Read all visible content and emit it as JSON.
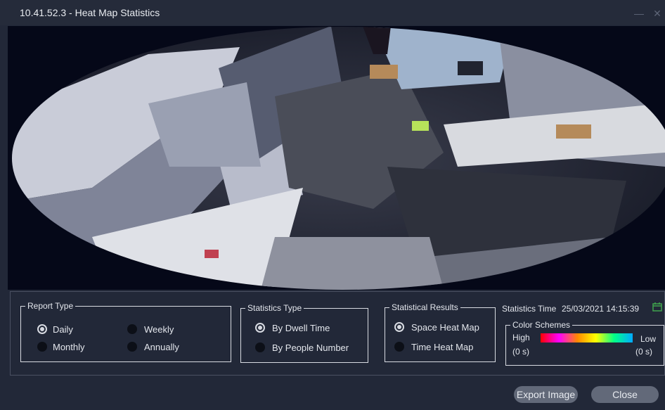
{
  "window": {
    "title": "10.41.52.3 - Heat Map Statistics",
    "minimize_icon": "minimize-icon",
    "close_icon": "close-icon"
  },
  "report_type": {
    "legend": "Report Type",
    "options": [
      {
        "label": "Daily",
        "selected": true
      },
      {
        "label": "Weekly",
        "selected": false
      },
      {
        "label": "Monthly",
        "selected": false
      },
      {
        "label": "Annually",
        "selected": false
      }
    ]
  },
  "statistics_type": {
    "legend": "Statistics Type",
    "options": [
      {
        "label": "By Dwell Time",
        "selected": true
      },
      {
        "label": "By People Number",
        "selected": false
      }
    ]
  },
  "statistical_results": {
    "legend": "Statistical Results",
    "options": [
      {
        "label": "Space Heat Map",
        "selected": true
      },
      {
        "label": "Time Heat Map",
        "selected": false
      }
    ]
  },
  "statistics_time": {
    "label": "Statistics Time",
    "value": "25/03/2021 14:15:39",
    "icon": "calendar-icon"
  },
  "color_schemes": {
    "legend": "Color Schemes",
    "high_label": "High",
    "high_value": "(0 s)",
    "low_label": "Low",
    "low_value": "(0 s)",
    "gradient_colors": [
      "#ff0000",
      "#ff00ff",
      "#ff8800",
      "#ffff00",
      "#00ff88",
      "#00aaff"
    ]
  },
  "buttons": {
    "export": "Export Image",
    "close": "Close"
  }
}
